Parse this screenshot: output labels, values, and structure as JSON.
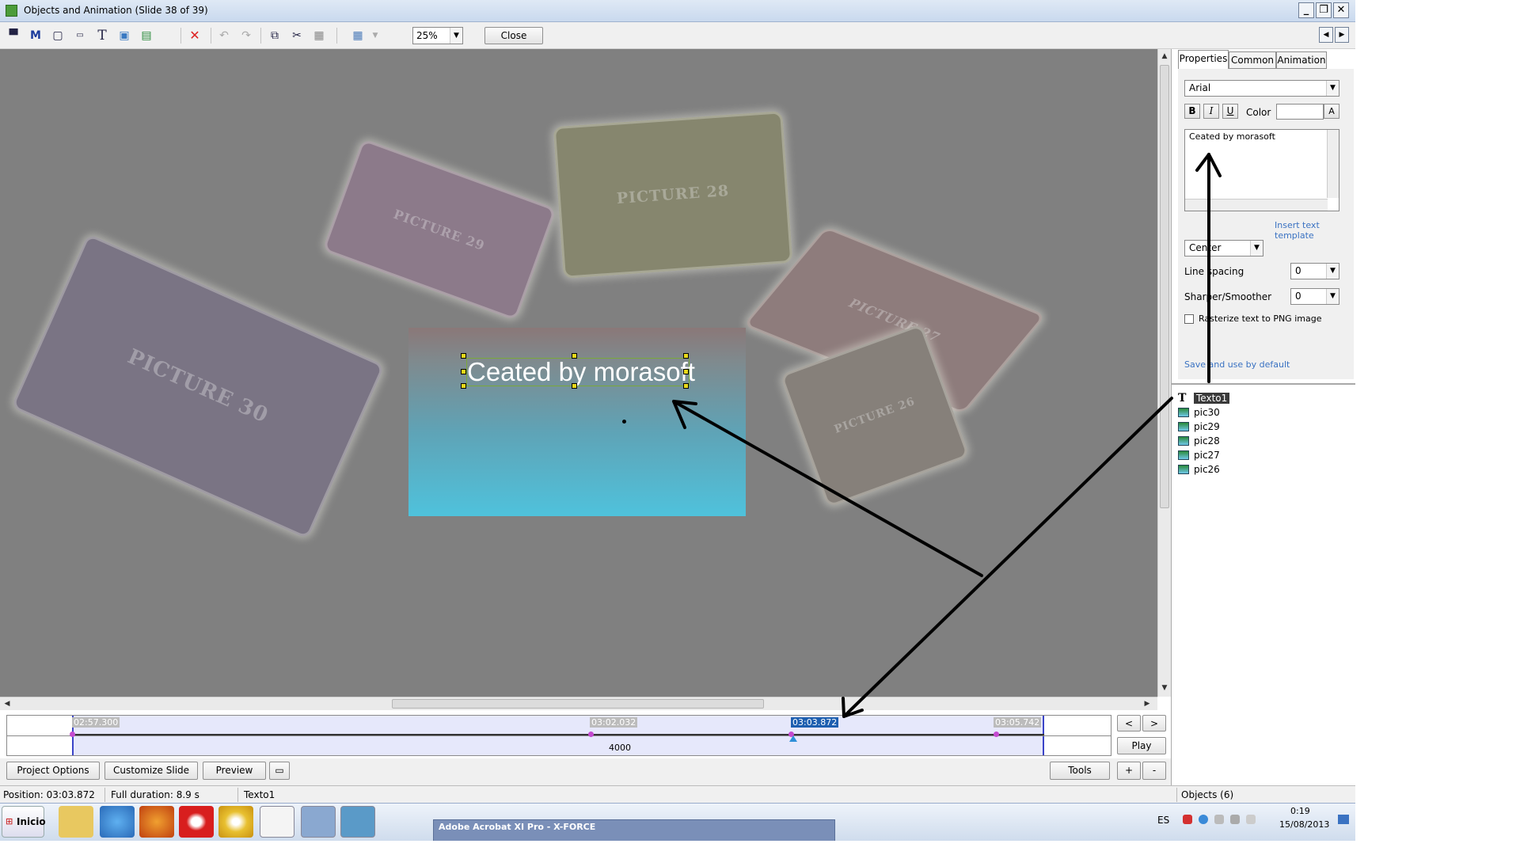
{
  "window": {
    "title": "Objects and Animation  (Slide 38 of 39)",
    "minimize_label": "_",
    "restore_label": "❐",
    "close_label": "✕"
  },
  "toolbar": {
    "zoom_value": "25%",
    "close_label": "Close",
    "tool_labels": [
      "M",
      "T"
    ]
  },
  "canvas": {
    "pictures": [
      "PICTURE 30",
      "PICTURE 29",
      "PICTURE 28",
      "PICTURE 27",
      "PICTURE 26"
    ],
    "selected_text": "Ceated by morasoft"
  },
  "tabs": [
    "Properties",
    "Common",
    "Animation"
  ],
  "properties": {
    "font": "Arial",
    "bold_label": "B",
    "italic_label": "I",
    "underline_label": "U",
    "color_label": "Color",
    "color_button_label": "A",
    "text_content": "Ceated by morasoft",
    "insert_template_link": "Insert text template",
    "alignment": "Center",
    "line_spacing_label": "Line spacing",
    "line_spacing_value": "0",
    "sharper_label": "Sharper/Smoother",
    "sharper_value": "0",
    "rasterize_label": "Rasterize text to PNG image",
    "save_default_link": "Save and use by default"
  },
  "objects": {
    "items": [
      "Texto1",
      "pic30",
      "pic29",
      "pic28",
      "pic27",
      "pic26"
    ],
    "count_label": "Objects (6)"
  },
  "timeline": {
    "times": [
      "02:57.300",
      "03:02.032",
      "03:03.872",
      "03:05.742"
    ],
    "duration_value": "4000",
    "prev_label": "<",
    "next_label": ">",
    "play_label": "Play",
    "plus_label": "+",
    "minus_label": "-"
  },
  "bottom_buttons": {
    "project_options": "Project Options",
    "customize_slide": "Customize Slide",
    "preview": "Preview",
    "tools": "Tools"
  },
  "status": {
    "position": "Position:  03:03.872",
    "full_duration": "Full duration:  8.9 s",
    "object_name": "Texto1"
  },
  "taskbar": {
    "start_label": "Inicio",
    "acrobat_label": "Adobe Acrobat XI Pro - X-FORCE",
    "language": "ES",
    "time": "0:19",
    "date": "15/08/2013"
  },
  "colors": {
    "canvas_bg": "#808080",
    "arrow": "#000000",
    "selection_band": "#e6e8fb",
    "current_time": "#1e5fb0"
  }
}
